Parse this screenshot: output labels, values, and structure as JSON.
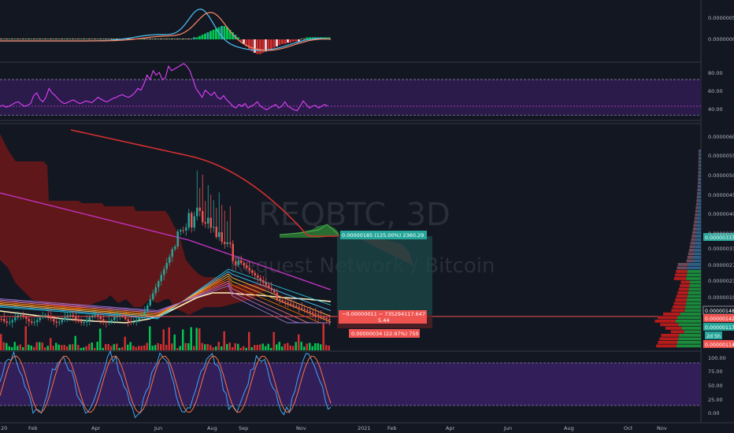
{
  "chart_data": [
    {
      "type": "line",
      "panel": "macd",
      "y_ticks": [
        "0.00000050",
        "0.00000000"
      ],
      "series": [],
      "histogram": [
        0,
        0,
        0,
        0,
        0,
        0,
        0,
        0,
        0,
        0,
        0,
        0,
        0,
        0,
        0,
        0,
        0,
        0,
        0,
        0,
        0,
        0,
        0,
        0,
        0,
        0,
        0,
        0,
        0,
        0,
        0,
        0,
        0,
        0,
        0,
        0,
        0,
        0,
        0,
        0,
        0,
        0,
        0,
        0,
        0,
        0,
        0,
        0,
        0,
        0,
        0,
        0,
        0,
        0,
        0,
        0,
        0,
        0,
        0,
        0,
        0,
        0,
        0,
        0,
        0,
        0,
        0,
        0,
        0,
        0,
        1,
        1,
        2,
        3,
        4,
        5,
        6,
        7,
        8,
        9,
        10,
        10,
        9,
        7,
        5,
        3,
        1,
        -1,
        -3,
        -5,
        -7,
        -9,
        -10,
        -11,
        -11,
        -10,
        -9,
        -8,
        -7,
        -6,
        -5,
        -4,
        -3,
        -3,
        -2,
        -2,
        -1,
        -1,
        -1,
        0,
        0,
        1,
        1,
        1,
        1,
        1,
        1,
        1,
        1,
        1
      ]
    },
    {
      "type": "line",
      "panel": "rsi",
      "y_ticks": [
        "80.00",
        "60.00",
        "40.00"
      ],
      "levels": [
        70,
        40,
        30
      ]
    },
    {
      "type": "candlestick",
      "panel": "price",
      "title": "REQBTC, 3D",
      "subtitle": "Request Network / Bitcoin",
      "y_ticks": [
        "0.00000600",
        "0.00000550",
        "0.00000500",
        "0.00000450",
        "0.00000400",
        "0.00000350",
        "0.00000310",
        "0.00000270",
        "0.00000230",
        "0.00000190",
        "0.00000148",
        "0.00000142",
        "0.00000117",
        "0.00000114"
      ],
      "price_labels": [
        {
          "text": "0.00000333",
          "color": "#26a69a"
        },
        {
          "text": "0.00000148",
          "color": "#131722"
        },
        {
          "text": "0.00000142",
          "color": "#ef5350"
        },
        {
          "text": "0.00000117",
          "color": "#26a69a"
        },
        {
          "text": "2d 5h",
          "color": "#26a69a"
        },
        {
          "text": "0.00000114",
          "color": "#ef5350"
        }
      ],
      "position_tool": {
        "target_label": "0.00000185 (125.00%) 2360.29",
        "center_label_1": "−0.00000011 ∼ 735294117.647",
        "center_label_2": "5.44",
        "stop_label": "0.00000034 (22.97%) 750"
      }
    },
    {
      "type": "line",
      "panel": "stoch_rsi",
      "y_ticks": [
        "100.00",
        "75.00",
        "50.00",
        "25.00",
        "0.00"
      ]
    }
  ],
  "x_axis_labels": [
    "20",
    "Feb",
    "Apr",
    "Jun",
    "Aug",
    "Sep",
    "Nov",
    "2021",
    "Feb",
    "Apr",
    "Jun",
    "Aug",
    "Oct",
    "Nov"
  ],
  "colors": {
    "background": "#131722",
    "up": "#26a69a",
    "down": "#ef5350",
    "volume_up": "#00c853",
    "volume_down": "#d32f2f",
    "rsi": "#e040fb",
    "purple_band": "#2a1a4a",
    "ma_red": "#d32f2f",
    "ma_magenta": "#c034c0",
    "ma_white": "#fff3c0"
  }
}
